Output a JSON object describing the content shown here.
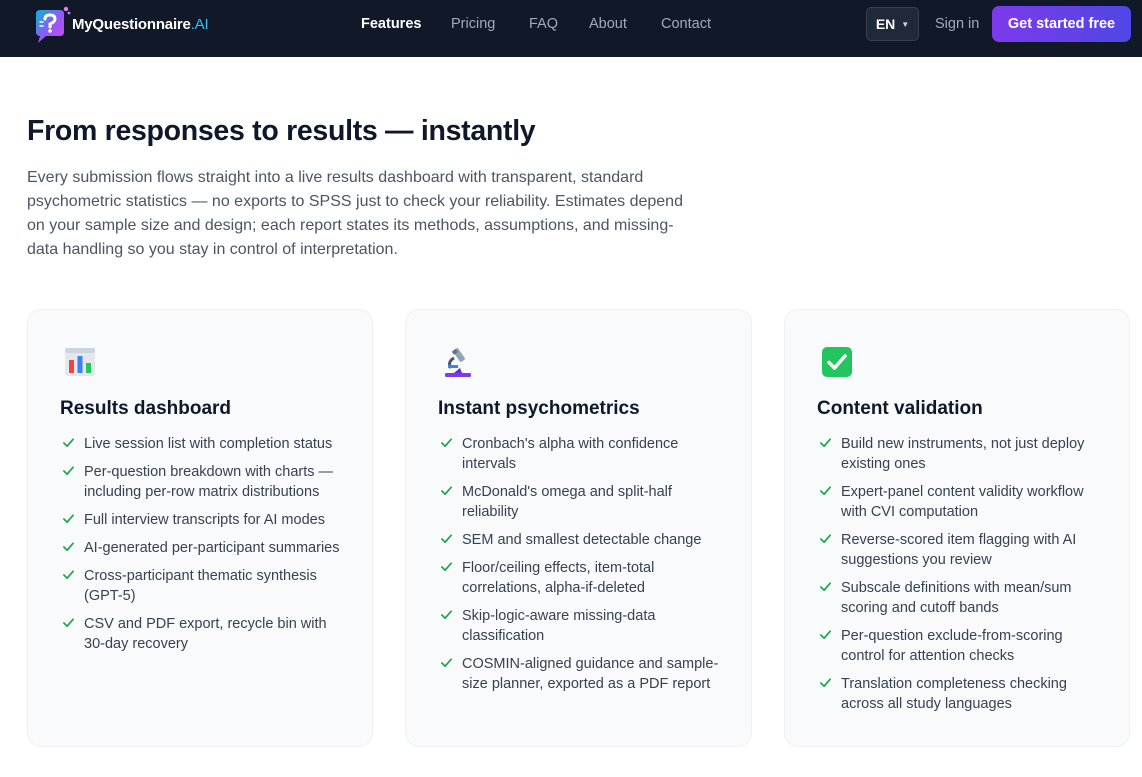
{
  "nav": {
    "brand_main": "MyQuestionnaire",
    "brand_suffix": ".AI",
    "links": [
      "Features",
      "Pricing",
      "FAQ",
      "About",
      "Contact"
    ],
    "language": "EN",
    "signin": "Sign in",
    "cta": "Get started free"
  },
  "hero": {
    "title": "From responses to results — instantly",
    "subtitle": "Every submission flows straight into a live results dashboard with transparent, standard psychometric statistics — no exports to SPSS just to check your reliability. Estimates depend on your sample size and design; each report states its methods, assumptions, and missing-data handling so you stay in control of interpretation."
  },
  "cards": [
    {
      "icon": "bar-chart-icon",
      "title": "Results dashboard",
      "items": [
        "Live session list with completion status",
        "Per-question breakdown with charts — including per-row matrix distributions",
        "Full interview transcripts for AI modes",
        "AI-generated per-participant summaries",
        "Cross-participant thematic synthesis (GPT-5)",
        "CSV and PDF export, recycle bin with 30-day recovery"
      ]
    },
    {
      "icon": "microscope-icon",
      "title": "Instant psychometrics",
      "items": [
        "Cronbach's alpha with confidence intervals",
        "McDonald's omega and split-half reliability",
        "SEM and smallest detectable change",
        "Floor/ceiling effects, item-total correlations, alpha-if-deleted",
        "Skip-logic-aware missing-data classification",
        "COSMIN-aligned guidance and sample-size planner, exported as a PDF report"
      ]
    },
    {
      "icon": "check-box-icon",
      "title": "Content validation",
      "items": [
        "Build new instruments, not just deploy existing ones",
        "Expert-panel content validity workflow with CVI computation",
        "Reverse-scored item flagging with AI suggestions you review",
        "Subscale definitions with mean/sum scoring and cutoff bands",
        "Per-question exclude-from-scoring control for attention checks",
        "Translation completeness checking across all study languages"
      ]
    }
  ],
  "colors": {
    "nav_bg": "#111827",
    "cta_start": "#7c3aed",
    "cta_end": "#4f46e5",
    "check": "#16a34a",
    "brand_ai": "#38bdf8"
  }
}
